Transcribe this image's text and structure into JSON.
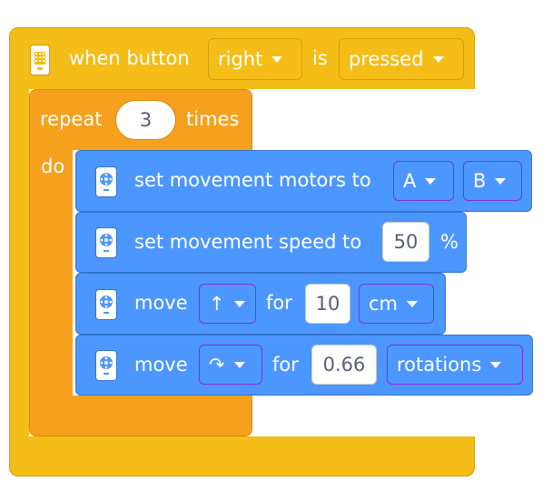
{
  "event": {
    "when_button": "when button",
    "button_value": "right",
    "is": "is",
    "state_value": "pressed"
  },
  "repeat": {
    "label": "repeat",
    "count": "3",
    "times": "times",
    "do": "do"
  },
  "blocks": [
    {
      "label": "set movement motors to",
      "port1": "A",
      "port2": "B"
    },
    {
      "label": "set movement speed to",
      "value": "50",
      "unit": "%"
    },
    {
      "label": "move",
      "direction": "↑",
      "for": "for",
      "amount": "10",
      "unit": "cm"
    },
    {
      "label": "move",
      "direction": "↷",
      "for": "for",
      "amount": "0.66",
      "unit": "rotations"
    }
  ],
  "colors": {
    "event": "#f5bd17",
    "repeat": "#f6a11d",
    "movement": "#4c97ff",
    "dropdown_border": "#8a2fcc"
  },
  "icons": {
    "event": "hub-icon",
    "movement": "movement-motor-icon"
  }
}
